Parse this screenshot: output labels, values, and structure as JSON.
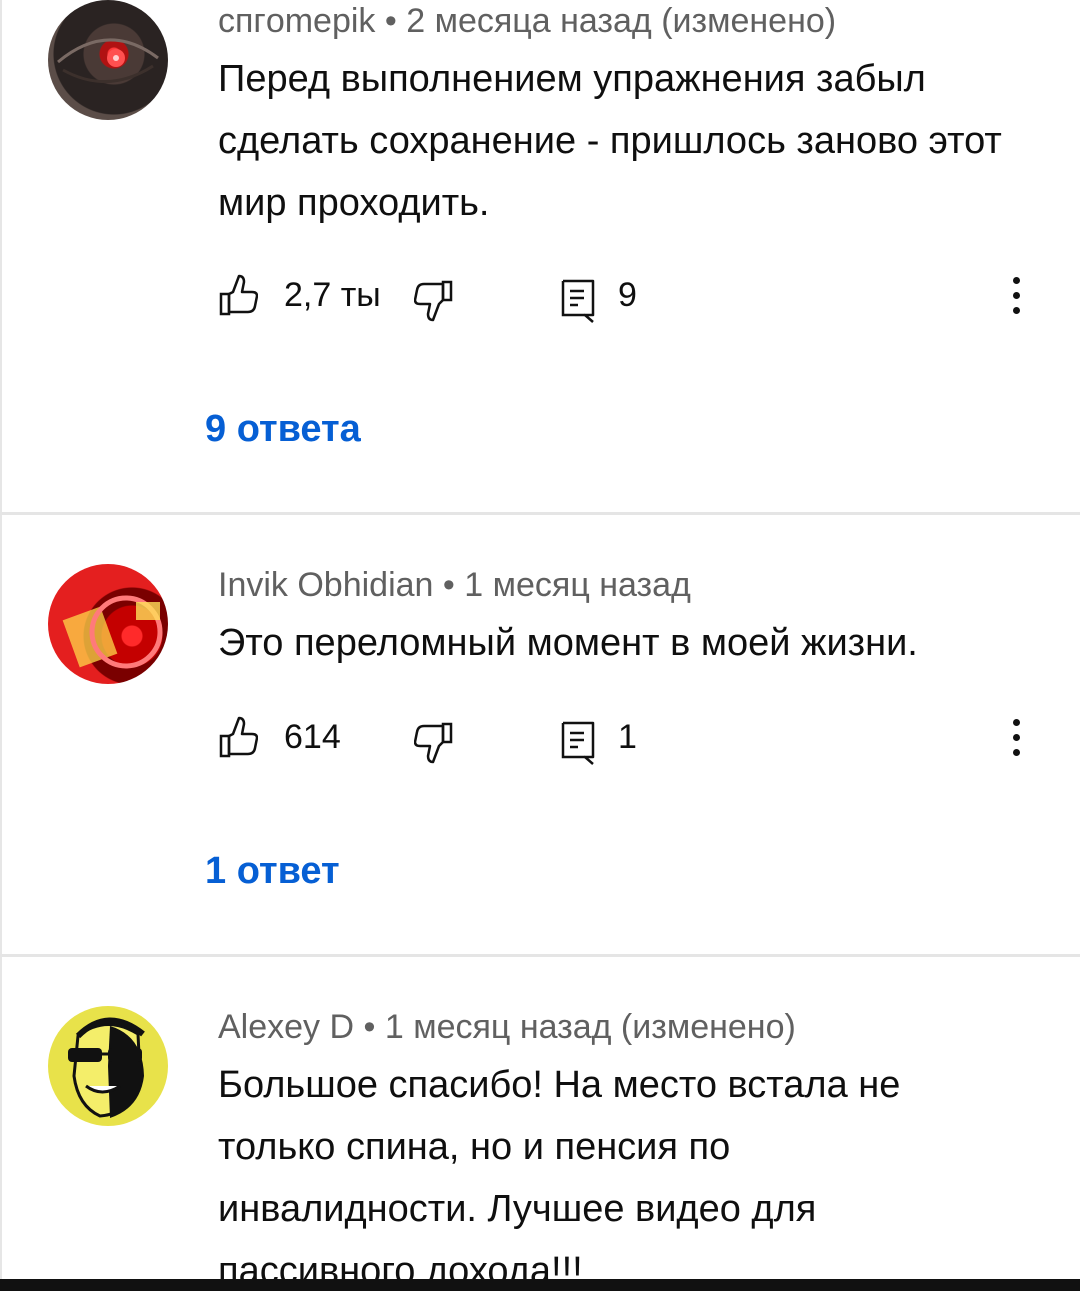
{
  "comments": [
    {
      "author": "cпгomepik",
      "time": "2 месяца назад (изменено)",
      "text": "Перед выполнением упражнения забыл сделать сохранение - пришлось заново этот мир проходить.",
      "likes": "2,7 ты",
      "reply_count": "9",
      "replies_link": "9 ответа"
    },
    {
      "author": "Invik Obhidian",
      "time": "1 месяц назад",
      "text": "Это переломный момент в моей жизни.",
      "likes": "614",
      "reply_count": "1",
      "replies_link": "1 ответ"
    },
    {
      "author": "Alexey D",
      "time": "1 месяц назад (изменено)",
      "text": "Большое спасибо! На место встала не только спина, но и пенсия по инвалидности. Лучшее видео для пассивного дохода!!!"
    }
  ],
  "meta_separator": "•",
  "icons": {
    "like": "thumb-up-icon",
    "dislike": "thumb-down-icon",
    "reply": "reply-comment-icon",
    "more": "more-vertical-icon"
  },
  "colors": {
    "link": "#065fd4",
    "meta": "#606060",
    "text": "#0f0f0f"
  }
}
